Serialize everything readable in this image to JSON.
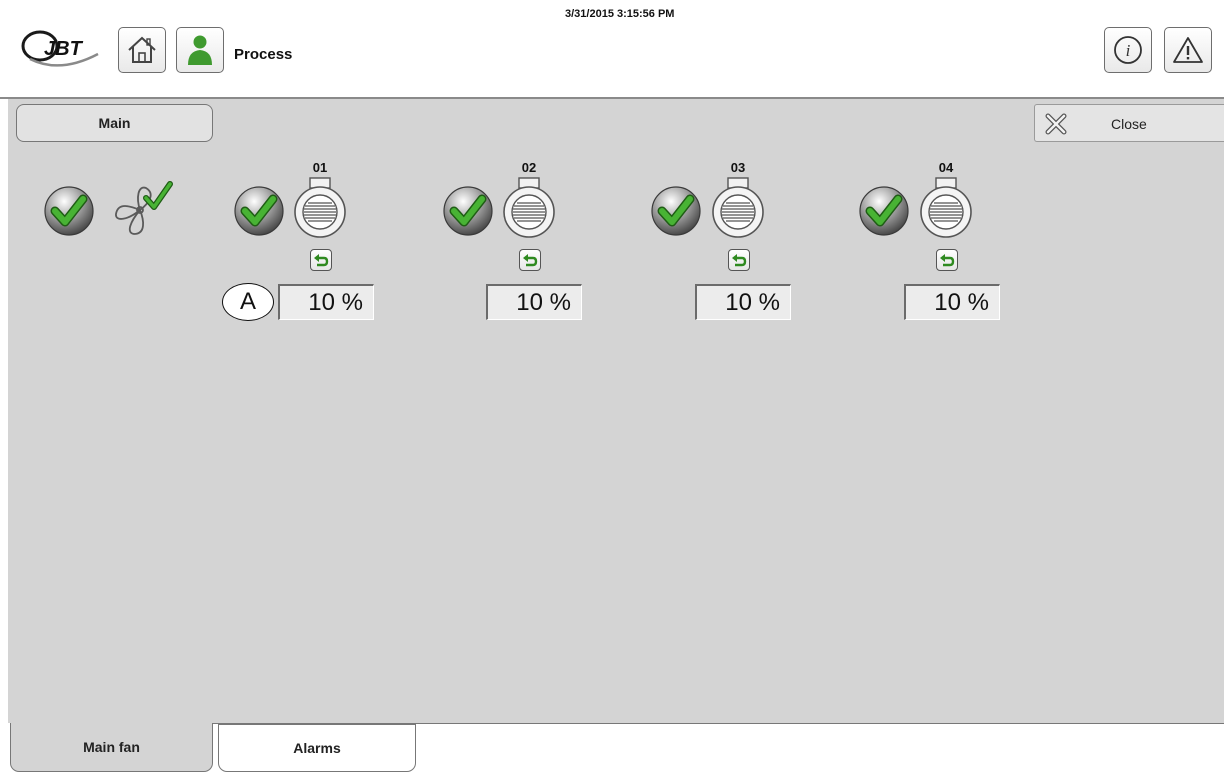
{
  "header": {
    "title": "Process",
    "datetime": "3/31/2015 3:15:56 PM"
  },
  "icons": {
    "logo": "jbt-logo",
    "home": "home-icon",
    "user": "user-icon",
    "info": "info-icon",
    "alarm": "warning-icon",
    "close": "close-icon",
    "fan": "fan-icon",
    "vent": "vent-icon",
    "reset": "reset-icon",
    "check": "checkmark-icon"
  },
  "colors": {
    "check_green": "#3aa62b",
    "user_green": "#3f9a2f",
    "panel": "#d4d4d4"
  },
  "main": {
    "tab_label": "Main",
    "close_label": "Close",
    "main_fan_ok": true,
    "zones": [
      {
        "label": "01",
        "value": "10 %",
        "ok": true
      },
      {
        "label": "02",
        "value": "10 %",
        "ok": true
      },
      {
        "label": "03",
        "value": "10 %",
        "ok": true
      },
      {
        "label": "04",
        "value": "10 %",
        "ok": true
      }
    ],
    "callout_label": "A"
  },
  "tabs": [
    {
      "label": "Main fan",
      "active": true
    },
    {
      "label": "Alarms",
      "active": false
    }
  ]
}
